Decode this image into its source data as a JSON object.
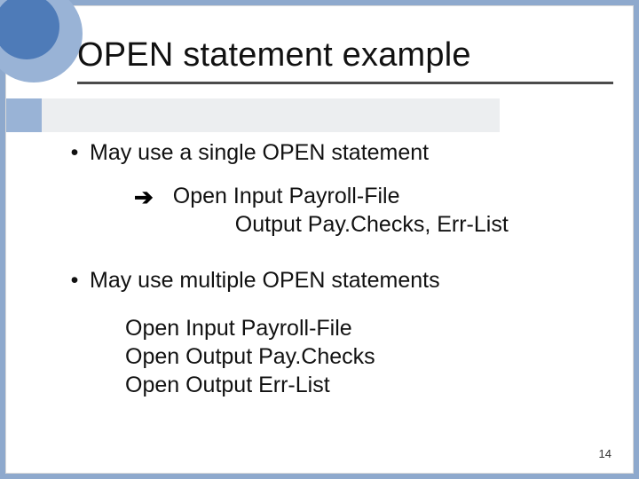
{
  "slide": {
    "title": "OPEN statement example",
    "bullets": [
      "May use a single OPEN statement",
      "May use multiple OPEN statements"
    ],
    "single_open": {
      "line1": "Open Input Payroll-File",
      "line2": "Output Pay.Checks, Err-List"
    },
    "multi_open": [
      "Open Input Payroll-File",
      "Open Output Pay.Checks",
      "Open Output Err-List"
    ],
    "page_number": "14"
  }
}
